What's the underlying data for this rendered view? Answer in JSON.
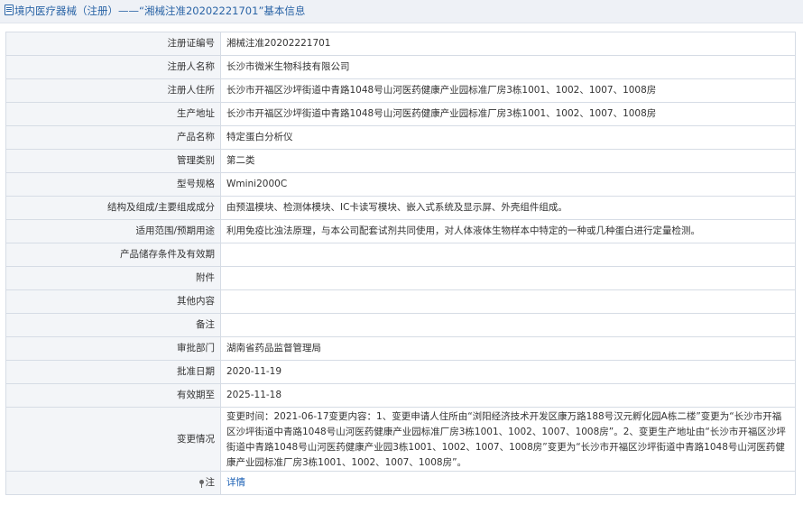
{
  "header": {
    "prefix": "境内医疗器械（注册）——",
    "title": "“湘械注准20202221701”基本信息"
  },
  "rows": [
    {
      "label": "注册证编号",
      "value": "湘械注准20202221701"
    },
    {
      "label": "注册人名称",
      "value": "长沙市微米生物科技有限公司"
    },
    {
      "label": "注册人住所",
      "value": "长沙市开福区沙坪街道中青路1048号山河医药健康产业园标准厂房3栋1001、1002、1007、1008房"
    },
    {
      "label": "生产地址",
      "value": "长沙市开福区沙坪街道中青路1048号山河医药健康产业园标准厂房3栋1001、1002、1007、1008房"
    },
    {
      "label": "产品名称",
      "value": "特定蛋白分析仪"
    },
    {
      "label": "管理类别",
      "value": "第二类"
    },
    {
      "label": "型号规格",
      "value": "Wmini2000C"
    },
    {
      "label": "结构及组成/主要组成成分",
      "value": "由预温模块、检测体模块、IC卡读写模块、嵌入式系统及显示屏、外壳组件组成。"
    },
    {
      "label": "适用范围/预期用途",
      "value": "利用免疫比浊法原理，与本公司配套试剂共同使用，对人体液体生物样本中特定的一种或几种蛋白进行定量检测。"
    },
    {
      "label": "产品储存条件及有效期",
      "value": ""
    },
    {
      "label": "附件",
      "value": ""
    },
    {
      "label": "其他内容",
      "value": ""
    },
    {
      "label": "备注",
      "value": ""
    },
    {
      "label": "审批部门",
      "value": "湖南省药品监督管理局"
    },
    {
      "label": "批准日期",
      "value": "2020-11-19"
    },
    {
      "label": "有效期至",
      "value": "2025-11-18"
    },
    {
      "label": "变更情况",
      "value": "变更时间：2021-06-17变更内容：1、变更申请人住所由“浏阳经济技术开发区康万路188号汉元孵化园A栋二楼”变更为“长沙市开福区沙坪街道中青路1048号山河医药健康产业园标准厂房3栋1001、1002、1007、1008房”。2、变更生产地址由“长沙市开福区沙坪街道中青路1048号山河医药健康产业园3栋1001、1002、1007、1008房”变更为“长沙市开福区沙坪街道中青路1048号山河医药健康产业园标准厂房3栋1001、1002、1007、1008房”。"
    }
  ],
  "note": {
    "label": "注",
    "link": "详情"
  }
}
